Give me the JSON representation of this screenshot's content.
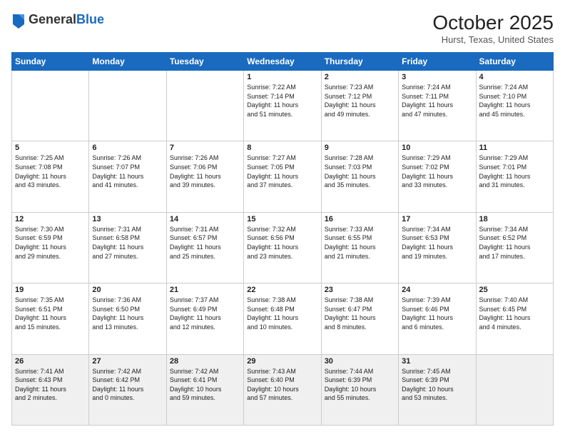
{
  "logo": {
    "general": "General",
    "blue": "Blue"
  },
  "header": {
    "month": "October 2025",
    "location": "Hurst, Texas, United States"
  },
  "weekdays": [
    "Sunday",
    "Monday",
    "Tuesday",
    "Wednesday",
    "Thursday",
    "Friday",
    "Saturday"
  ],
  "weeks": [
    [
      {
        "day": "",
        "info": ""
      },
      {
        "day": "",
        "info": ""
      },
      {
        "day": "",
        "info": ""
      },
      {
        "day": "1",
        "info": "Sunrise: 7:22 AM\nSunset: 7:14 PM\nDaylight: 11 hours\nand 51 minutes."
      },
      {
        "day": "2",
        "info": "Sunrise: 7:23 AM\nSunset: 7:12 PM\nDaylight: 11 hours\nand 49 minutes."
      },
      {
        "day": "3",
        "info": "Sunrise: 7:24 AM\nSunset: 7:11 PM\nDaylight: 11 hours\nand 47 minutes."
      },
      {
        "day": "4",
        "info": "Sunrise: 7:24 AM\nSunset: 7:10 PM\nDaylight: 11 hours\nand 45 minutes."
      }
    ],
    [
      {
        "day": "5",
        "info": "Sunrise: 7:25 AM\nSunset: 7:08 PM\nDaylight: 11 hours\nand 43 minutes."
      },
      {
        "day": "6",
        "info": "Sunrise: 7:26 AM\nSunset: 7:07 PM\nDaylight: 11 hours\nand 41 minutes."
      },
      {
        "day": "7",
        "info": "Sunrise: 7:26 AM\nSunset: 7:06 PM\nDaylight: 11 hours\nand 39 minutes."
      },
      {
        "day": "8",
        "info": "Sunrise: 7:27 AM\nSunset: 7:05 PM\nDaylight: 11 hours\nand 37 minutes."
      },
      {
        "day": "9",
        "info": "Sunrise: 7:28 AM\nSunset: 7:03 PM\nDaylight: 11 hours\nand 35 minutes."
      },
      {
        "day": "10",
        "info": "Sunrise: 7:29 AM\nSunset: 7:02 PM\nDaylight: 11 hours\nand 33 minutes."
      },
      {
        "day": "11",
        "info": "Sunrise: 7:29 AM\nSunset: 7:01 PM\nDaylight: 11 hours\nand 31 minutes."
      }
    ],
    [
      {
        "day": "12",
        "info": "Sunrise: 7:30 AM\nSunset: 6:59 PM\nDaylight: 11 hours\nand 29 minutes."
      },
      {
        "day": "13",
        "info": "Sunrise: 7:31 AM\nSunset: 6:58 PM\nDaylight: 11 hours\nand 27 minutes."
      },
      {
        "day": "14",
        "info": "Sunrise: 7:31 AM\nSunset: 6:57 PM\nDaylight: 11 hours\nand 25 minutes."
      },
      {
        "day": "15",
        "info": "Sunrise: 7:32 AM\nSunset: 6:56 PM\nDaylight: 11 hours\nand 23 minutes."
      },
      {
        "day": "16",
        "info": "Sunrise: 7:33 AM\nSunset: 6:55 PM\nDaylight: 11 hours\nand 21 minutes."
      },
      {
        "day": "17",
        "info": "Sunrise: 7:34 AM\nSunset: 6:53 PM\nDaylight: 11 hours\nand 19 minutes."
      },
      {
        "day": "18",
        "info": "Sunrise: 7:34 AM\nSunset: 6:52 PM\nDaylight: 11 hours\nand 17 minutes."
      }
    ],
    [
      {
        "day": "19",
        "info": "Sunrise: 7:35 AM\nSunset: 6:51 PM\nDaylight: 11 hours\nand 15 minutes."
      },
      {
        "day": "20",
        "info": "Sunrise: 7:36 AM\nSunset: 6:50 PM\nDaylight: 11 hours\nand 13 minutes."
      },
      {
        "day": "21",
        "info": "Sunrise: 7:37 AM\nSunset: 6:49 PM\nDaylight: 11 hours\nand 12 minutes."
      },
      {
        "day": "22",
        "info": "Sunrise: 7:38 AM\nSunset: 6:48 PM\nDaylight: 11 hours\nand 10 minutes."
      },
      {
        "day": "23",
        "info": "Sunrise: 7:38 AM\nSunset: 6:47 PM\nDaylight: 11 hours\nand 8 minutes."
      },
      {
        "day": "24",
        "info": "Sunrise: 7:39 AM\nSunset: 6:46 PM\nDaylight: 11 hours\nand 6 minutes."
      },
      {
        "day": "25",
        "info": "Sunrise: 7:40 AM\nSunset: 6:45 PM\nDaylight: 11 hours\nand 4 minutes."
      }
    ],
    [
      {
        "day": "26",
        "info": "Sunrise: 7:41 AM\nSunset: 6:43 PM\nDaylight: 11 hours\nand 2 minutes."
      },
      {
        "day": "27",
        "info": "Sunrise: 7:42 AM\nSunset: 6:42 PM\nDaylight: 11 hours\nand 0 minutes."
      },
      {
        "day": "28",
        "info": "Sunrise: 7:42 AM\nSunset: 6:41 PM\nDaylight: 10 hours\nand 59 minutes."
      },
      {
        "day": "29",
        "info": "Sunrise: 7:43 AM\nSunset: 6:40 PM\nDaylight: 10 hours\nand 57 minutes."
      },
      {
        "day": "30",
        "info": "Sunrise: 7:44 AM\nSunset: 6:39 PM\nDaylight: 10 hours\nand 55 minutes."
      },
      {
        "day": "31",
        "info": "Sunrise: 7:45 AM\nSunset: 6:39 PM\nDaylight: 10 hours\nand 53 minutes."
      },
      {
        "day": "",
        "info": ""
      }
    ]
  ]
}
